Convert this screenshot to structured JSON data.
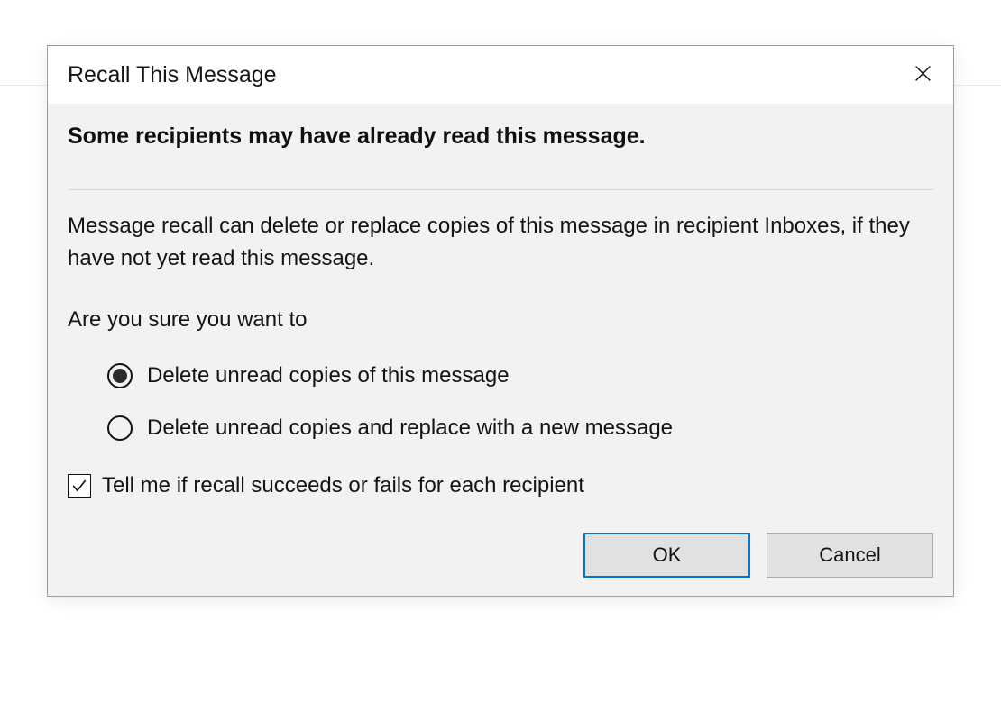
{
  "dialog": {
    "title": "Recall This Message",
    "headline": "Some recipients may have already read this message.",
    "description": "Message recall can delete or replace copies of this message in recipient Inboxes, if they have not yet read this message.",
    "prompt": "Are you sure you want to",
    "options": {
      "delete": "Delete unread copies of this message",
      "replace": "Delete unread copies and replace with a new message"
    },
    "selected_option": "delete",
    "checkbox_label": "Tell me if recall succeeds or fails for each recipient",
    "checkbox_checked": true,
    "buttons": {
      "ok": "OK",
      "cancel": "Cancel"
    }
  }
}
